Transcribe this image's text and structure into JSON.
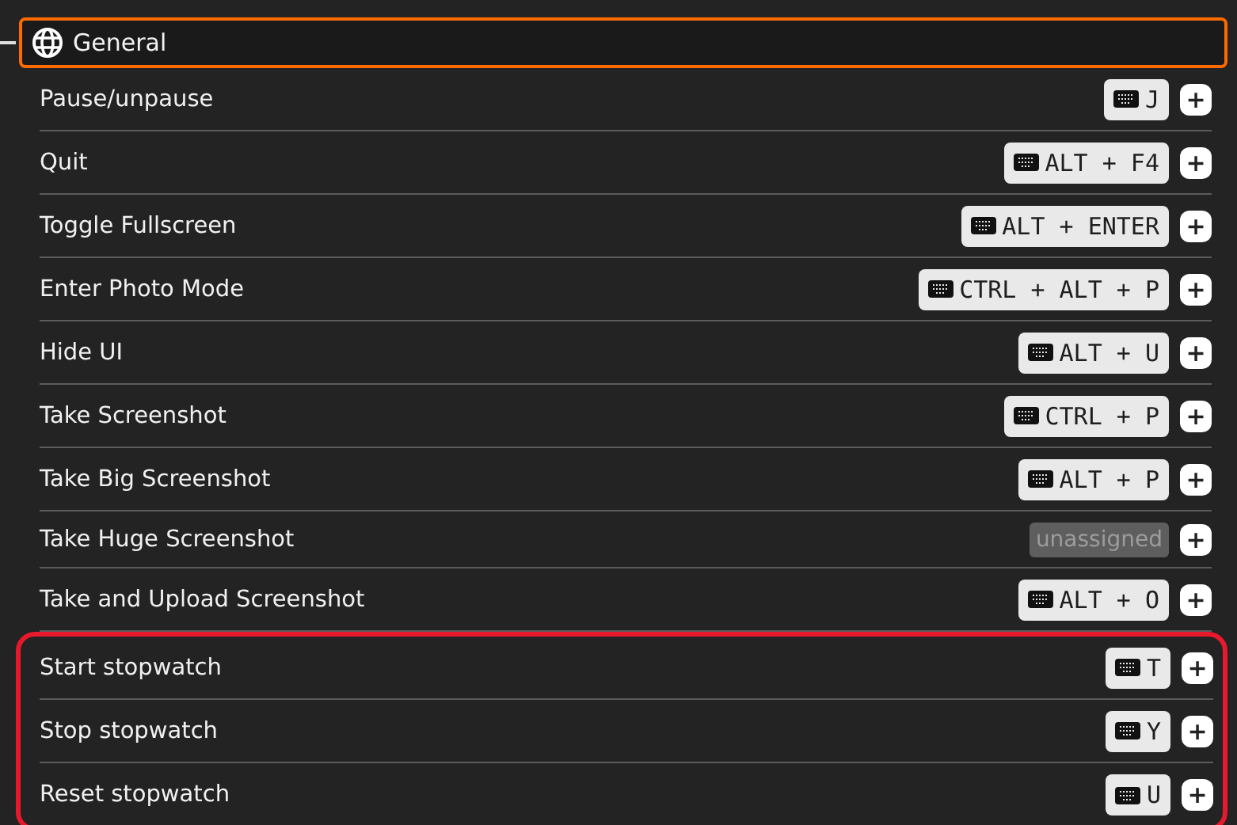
{
  "section": {
    "title": "General",
    "focused": true
  },
  "groups": [
    {
      "highlighted": false,
      "rows": [
        {
          "label": "Pause/unpause",
          "kind": "binding",
          "key": "J",
          "add": "+"
        },
        {
          "label": "Quit",
          "kind": "binding",
          "key": "ALT + F4",
          "add": "+"
        },
        {
          "label": "Toggle Fullscreen",
          "kind": "binding",
          "key": "ALT + ENTER",
          "add": "+"
        },
        {
          "label": "Enter Photo Mode",
          "kind": "binding",
          "key": "CTRL + ALT + P",
          "add": "+"
        },
        {
          "label": "Hide UI",
          "kind": "binding",
          "key": "ALT + U",
          "add": "+"
        },
        {
          "label": "Take Screenshot",
          "kind": "binding",
          "key": "CTRL + P",
          "add": "+"
        },
        {
          "label": "Take Big Screenshot",
          "kind": "binding",
          "key": "ALT + P",
          "add": "+"
        },
        {
          "label": "Take Huge Screenshot",
          "kind": "unassigned",
          "key": "unassigned",
          "add": "+"
        },
        {
          "label": "Take and Upload Screenshot",
          "kind": "binding",
          "key": "ALT + O",
          "add": "+"
        }
      ]
    },
    {
      "highlighted": true,
      "rows": [
        {
          "label": "Start stopwatch",
          "kind": "binding",
          "key": "T",
          "add": "+"
        },
        {
          "label": "Stop stopwatch",
          "kind": "binding",
          "key": "Y",
          "add": "+"
        },
        {
          "label": "Reset stopwatch",
          "kind": "binding",
          "key": "U",
          "add": "+"
        }
      ]
    }
  ]
}
